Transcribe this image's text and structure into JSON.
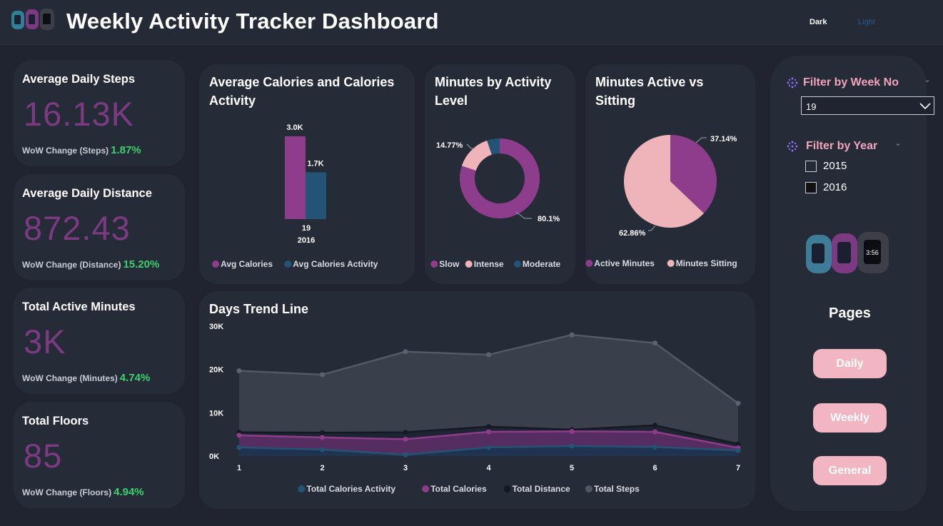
{
  "header": {
    "title": "Weekly Activity Tracker Dashboard",
    "theme_dark": "Dark",
    "theme_light": "Light"
  },
  "kpis": [
    {
      "title": "Average Daily Steps",
      "value": "16.13K",
      "change_label": "WoW Change (Steps)",
      "change": "1.87%"
    },
    {
      "title": "Average Daily Distance",
      "value": "872.43",
      "change_label": "WoW Change (Distance)",
      "change": "15.20%"
    },
    {
      "title": "Total Active Minutes",
      "value": "3K",
      "change_label": "WoW Change (Minutes)",
      "change": "4.74%"
    },
    {
      "title": "Total Floors",
      "value": "85",
      "change_label": "WoW Change (Floors)",
      "change": "4.94%"
    }
  ],
  "filters": {
    "week_label": "Filter by Week No",
    "week_value": "19",
    "year_label": "Filter by Year",
    "years": [
      "2015",
      "2016"
    ]
  },
  "pages": {
    "title": "Pages",
    "buttons": [
      "Daily",
      "Weekly",
      "General"
    ]
  },
  "colors": {
    "purple": "#8e3c8c",
    "blue": "#235376",
    "pink": "#eeb4b9",
    "gray": "#4f5764",
    "navy": "#1a2030",
    "positive": "#3bd16f"
  },
  "chart_data": [
    {
      "type": "bar",
      "title": "Average Calories and Calories Activity",
      "categories": [
        "19"
      ],
      "category_group": "2016",
      "series": [
        {
          "name": "Avg Calories",
          "values": [
            3000
          ],
          "label": "3.0K"
        },
        {
          "name": "Avg Calories Activity",
          "values": [
            1700
          ],
          "label": "1.7K"
        }
      ],
      "ylim": [
        0,
        3000
      ],
      "legend": "bottom"
    },
    {
      "type": "pie",
      "variant": "donut",
      "title": "Minutes by Activity Level",
      "labels": [
        "Slow",
        "Intense",
        "Moderate"
      ],
      "values": [
        80.1,
        14.77,
        5.13
      ],
      "shown_labels": [
        "80.1%",
        "14.77%",
        ""
      ],
      "legend": "bottom"
    },
    {
      "type": "pie",
      "title": "Minutes Active vs Sitting",
      "labels": [
        "Active Minutes",
        "Minutes Sitting"
      ],
      "values": [
        37.14,
        62.86
      ],
      "shown_labels": [
        "37.14%",
        "62.86%"
      ],
      "legend": "bottom"
    },
    {
      "type": "area",
      "title": "Days Trend Line",
      "x": [
        1,
        2,
        3,
        4,
        5,
        6,
        7
      ],
      "yticks": [
        "0K",
        "10K",
        "20K",
        "30K"
      ],
      "ylim": [
        0,
        30000
      ],
      "series": [
        {
          "name": "Total Calories Activity",
          "values": [
            2000,
            1500,
            300,
            2000,
            2300,
            2100,
            1300
          ]
        },
        {
          "name": "Total Calories",
          "values": [
            4800,
            4300,
            3900,
            5600,
            5700,
            5600,
            1900
          ]
        },
        {
          "name": "Total Distance",
          "values": [
            5500,
            5400,
            5500,
            6800,
            6100,
            7100,
            2800
          ]
        },
        {
          "name": "Total Steps",
          "values": [
            19700,
            18800,
            24100,
            23400,
            28000,
            26100,
            12200
          ]
        }
      ],
      "legend": "bottom"
    }
  ]
}
